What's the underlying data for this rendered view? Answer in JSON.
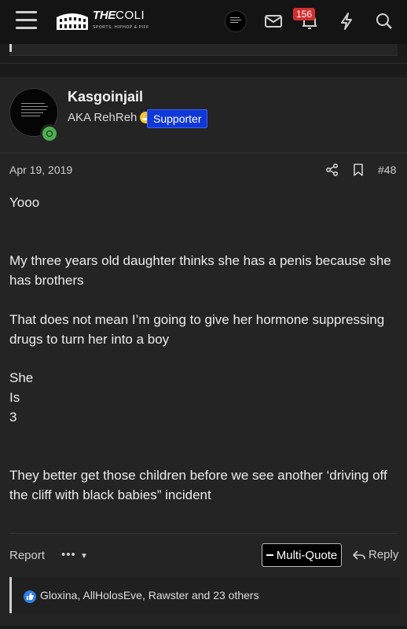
{
  "header": {
    "logo_title": "THE COLI",
    "logo_part1": "THE",
    "logo_part2": "COLI",
    "logo_subtitle": "SPORTS, HIPHOP & PIFF",
    "notification_count": "156",
    "icons": [
      "hamburger-icon",
      "mail-icon",
      "bell-icon",
      "lightning-icon",
      "search-icon"
    ]
  },
  "post": {
    "username": "Kasgoinjail",
    "user_title": "AKA RehReh",
    "role_badge": "Supporter",
    "date": "Apr 19, 2019",
    "post_number": "#48",
    "body": {
      "p1": "Yooo",
      "p2": "My three years old daughter thinks she has a penis because she has brothers",
      "p3": "That does not mean I’m going to give her hormone suppressing drugs to turn her into a boy",
      "p4a": "She",
      "p4b": "Is",
      "p4c": "3",
      "p5": "They better get those children before we see another ‘driving off the cliff with black babies” incident"
    },
    "actions": {
      "report": "Report",
      "more": "•••",
      "multi_quote": "Multi-Quote",
      "reply": "Reply"
    },
    "reactions": "Gloxina, AllHolosEve, Rawster and 23 others"
  },
  "colors": {
    "background": "#1b1b1b",
    "post_background": "#242424",
    "supporter_badge": "#1037d8",
    "notification_badge": "#d32f2f",
    "online_indicator": "#4caf50",
    "like_icon": "#2f80ed"
  }
}
